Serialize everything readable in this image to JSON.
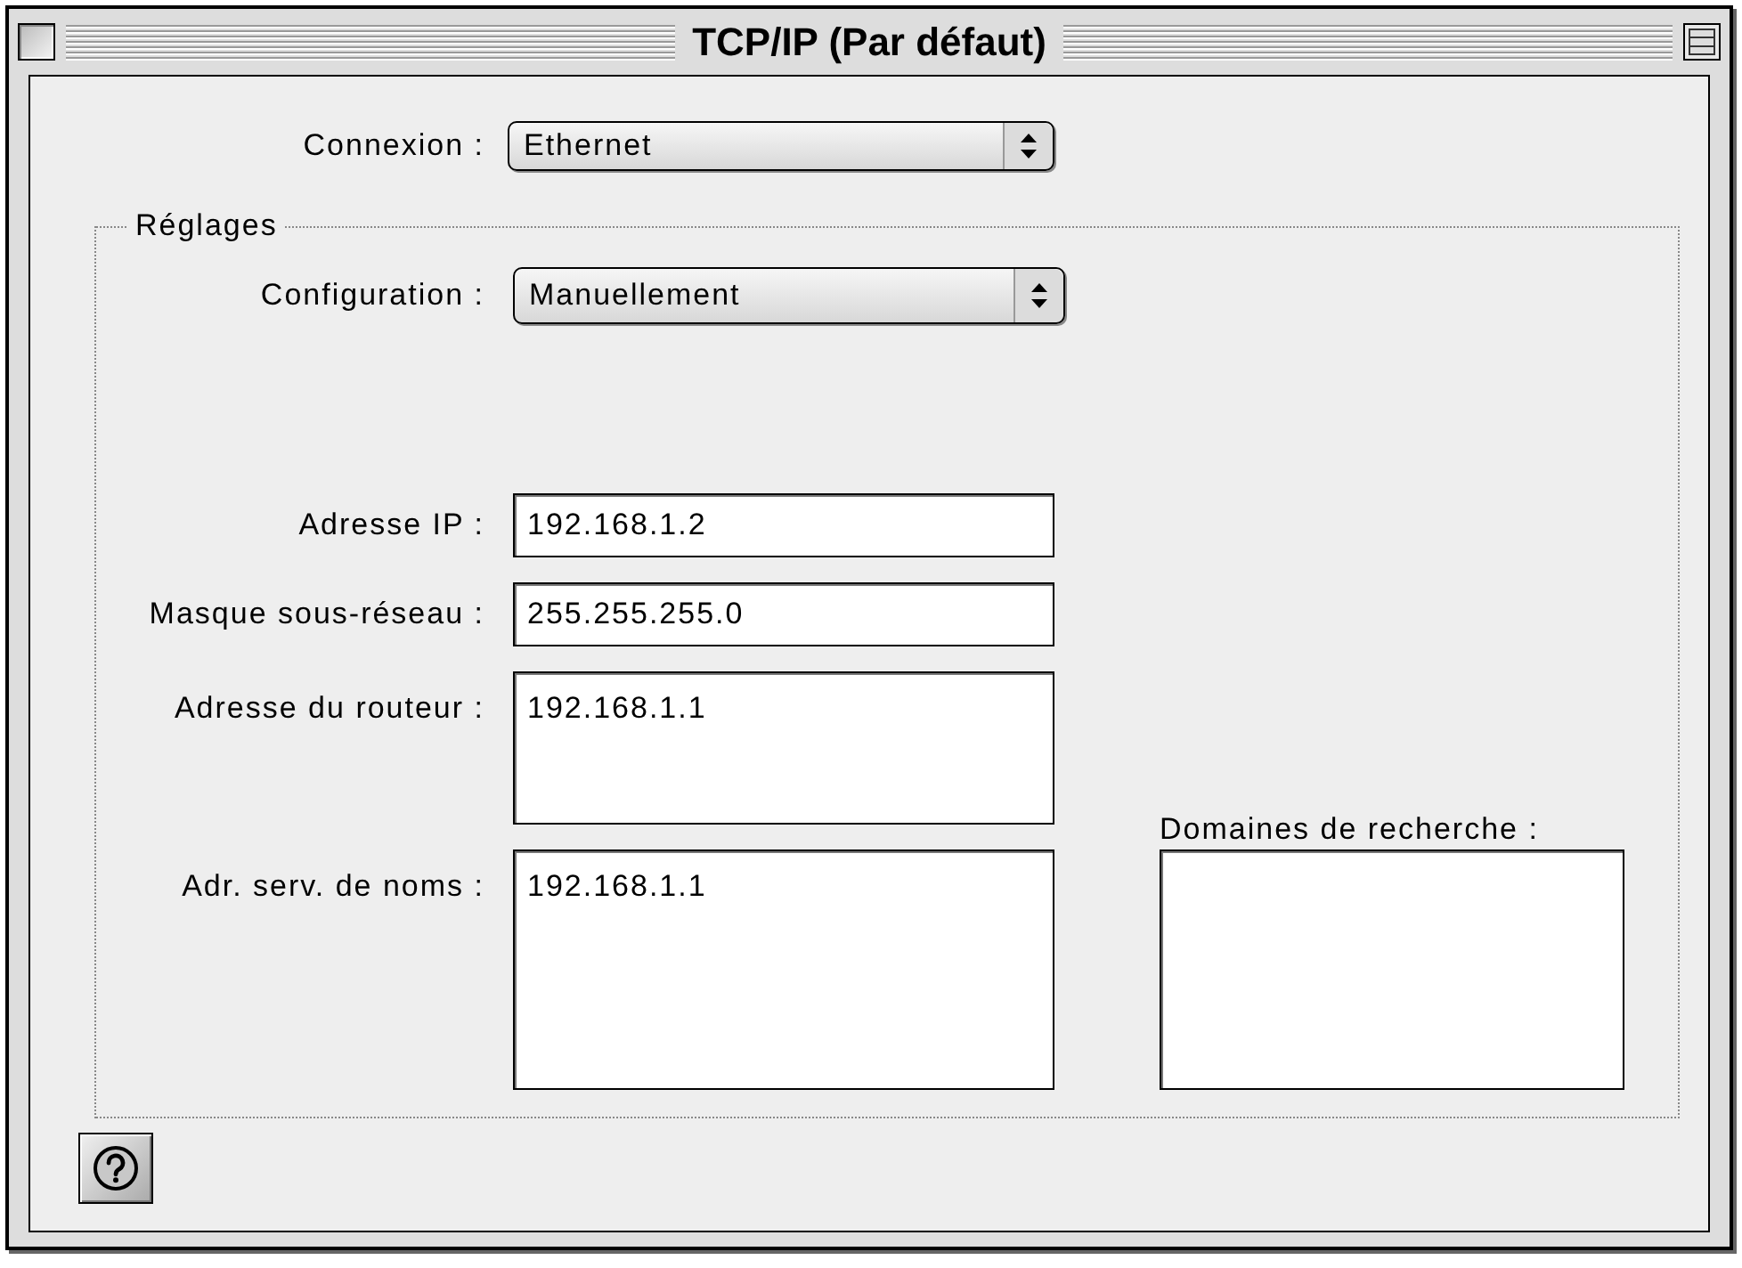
{
  "window": {
    "title": "TCP/IP (Par défaut)"
  },
  "connection": {
    "label": "Connexion :",
    "value": "Ethernet"
  },
  "settings": {
    "title": "Réglages",
    "configuration": {
      "label": "Configuration :",
      "value": "Manuellement"
    },
    "fields": [
      {
        "label": "Adresse IP :",
        "value": "192.168.1.2",
        "kind": "single"
      },
      {
        "label": "Masque sous-réseau :",
        "value": "255.255.255.0",
        "kind": "single"
      },
      {
        "label": "Adresse du routeur :",
        "value": "192.168.1.1",
        "kind": "multi"
      },
      {
        "label": "Adr. serv. de noms :",
        "value": "192.168.1.1",
        "kind": "multi"
      }
    ],
    "search_domains": {
      "label": "Domaines de recherche :"
    }
  }
}
